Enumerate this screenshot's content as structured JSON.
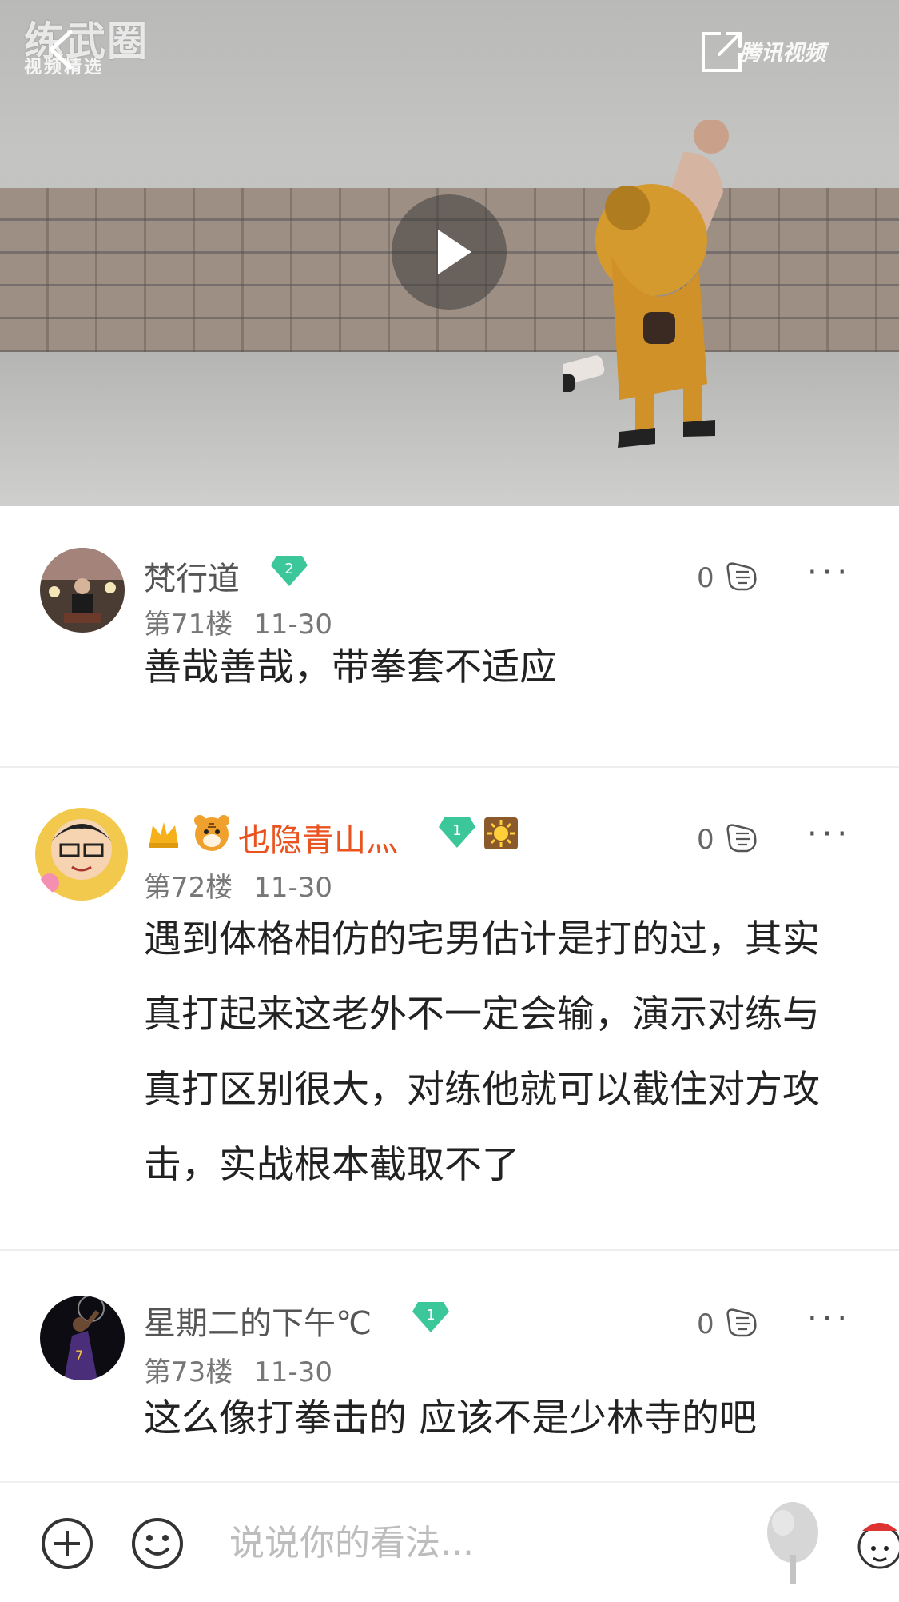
{
  "video": {
    "watermark_title": "练武圈",
    "watermark_sub": "视频精选",
    "provider": "腾讯视频"
  },
  "comments": [
    {
      "username": "梵行道",
      "level": "2",
      "floor": "第71楼",
      "date": "11-30",
      "text": "善哉善哉，带拳套不适应",
      "likes": "0"
    },
    {
      "username": "也隐青山灬",
      "level": "1",
      "floor": "第72楼",
      "date": "11-30",
      "text": "遇到体格相仿的宅男估计是打的过，其实真打起来这老外不一定会输，演示对练与真打区别很大，对练他就可以截住对方攻击，实战根本截取不了",
      "likes": "0"
    },
    {
      "username": "星期二的下午℃",
      "level": "1",
      "floor": "第73楼",
      "date": "11-30",
      "text": "这么像打拳击的 应该不是少林寺的吧",
      "likes": "0"
    }
  ],
  "composer": {
    "placeholder": "说说你的看法..."
  },
  "colors": {
    "level_badge": "#3cc79a",
    "vip_name": "#e8531f"
  },
  "icons": [
    "back-arrow-icon",
    "share-icon",
    "play-icon",
    "like-hand-icon",
    "more-icon",
    "plus-icon",
    "emoji-icon",
    "tree-icon",
    "sticker-icon",
    "crown-icon",
    "tiger-icon",
    "sun-badge-icon"
  ]
}
